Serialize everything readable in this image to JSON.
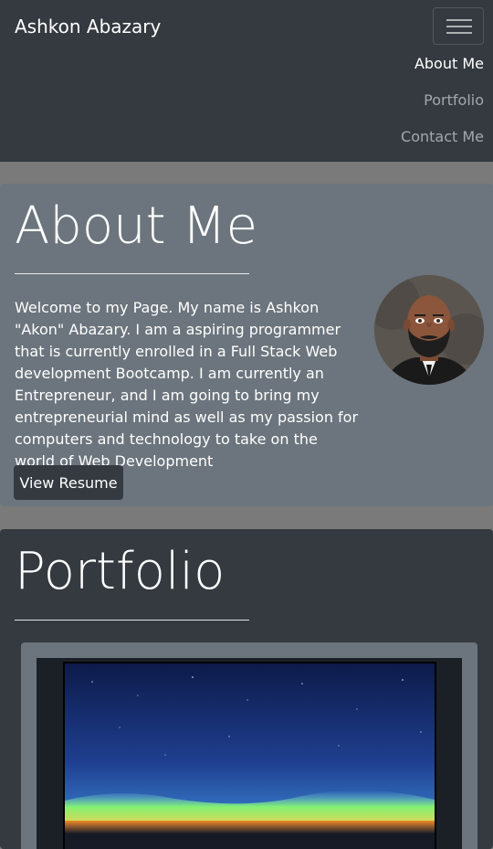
{
  "navbar": {
    "brand": "Ashkon Abazary",
    "links": [
      {
        "label": "About Me",
        "active": true
      },
      {
        "label": "Portfolio",
        "active": false
      },
      {
        "label": "Contact Me",
        "active": false
      }
    ],
    "toggler_icon": "hamburger-icon"
  },
  "about": {
    "title": "About Me",
    "text": "Welcome to my Page. My name is Ashkon \"Akon\" Abazary. I am a aspiring programmer that is currently enrolled in a Full Stack Web development Bootcamp. I am currently an Entrepreneur, and I am going to bring my entrepreneurial mind as well as my passion for computers and technology to take on the world of Web Development",
    "resume_button": "View Resume"
  },
  "portfolio": {
    "title": "Portfolio"
  },
  "colors": {
    "navbar_bg": "#343a40",
    "about_bg": "#6c757d",
    "page_bg": "#7a7a7a"
  }
}
